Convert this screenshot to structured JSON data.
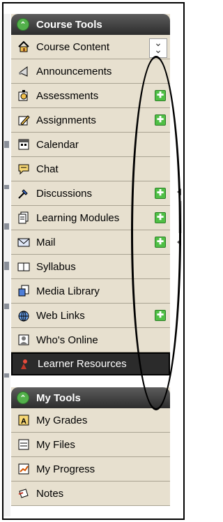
{
  "course_tools": {
    "title": "Course Tools",
    "items": [
      {
        "label": "Course Content",
        "icon": "house-icon",
        "has_new": false
      },
      {
        "label": "Announcements",
        "icon": "megaphone-icon",
        "has_new": false
      },
      {
        "label": "Assessments",
        "icon": "stopwatch-icon",
        "has_new": true
      },
      {
        "label": "Assignments",
        "icon": "pencil-paper-icon",
        "has_new": true
      },
      {
        "label": "Calendar",
        "icon": "calendar-icon",
        "has_new": false
      },
      {
        "label": "Chat",
        "icon": "speech-bubble-icon",
        "has_new": false
      },
      {
        "label": "Discussions",
        "icon": "pushpin-icon",
        "has_new": true
      },
      {
        "label": "Learning Modules",
        "icon": "document-stack-icon",
        "has_new": true
      },
      {
        "label": "Mail",
        "icon": "envelope-icon",
        "has_new": true
      },
      {
        "label": "Syllabus",
        "icon": "book-icon",
        "has_new": false
      },
      {
        "label": "Media Library",
        "icon": "media-icon",
        "has_new": false
      },
      {
        "label": "Web Links",
        "icon": "globe-icon",
        "has_new": true
      },
      {
        "label": "Who's Online",
        "icon": "person-icon",
        "has_new": false
      },
      {
        "label": "Learner Resources",
        "icon": "learner-icon",
        "has_new": false
      }
    ]
  },
  "my_tools": {
    "title": "My Tools",
    "items": [
      {
        "label": "My Grades",
        "icon": "grades-icon"
      },
      {
        "label": "My Files",
        "icon": "files-icon"
      },
      {
        "label": "My Progress",
        "icon": "progress-chart-icon"
      },
      {
        "label": "Notes",
        "icon": "notes-icon"
      }
    ]
  },
  "new_badge_symbol": "✚",
  "colors": {
    "panel": "#e7e0cf",
    "header": "#3d3d3d",
    "new_badge": "#4fbf45"
  }
}
